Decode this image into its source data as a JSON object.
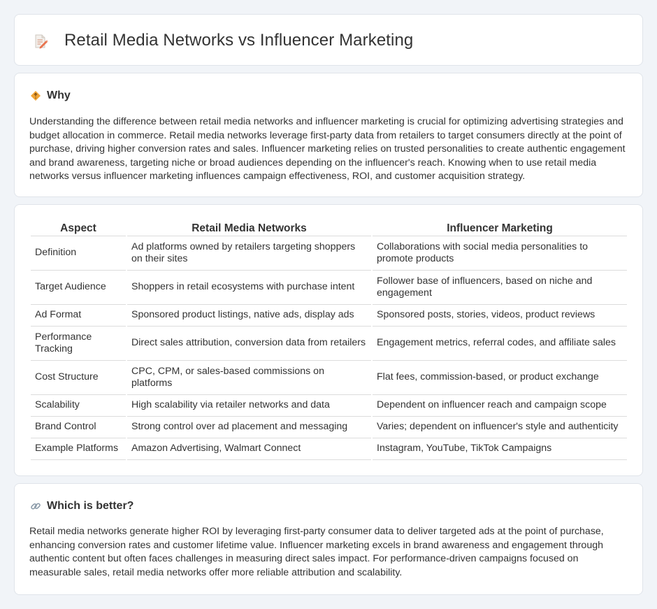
{
  "header": {
    "title": "Retail Media Networks vs Influencer Marketing",
    "icon": "document-pencil-icon"
  },
  "why": {
    "heading": "Why",
    "icon": "diamond-sign-icon",
    "text": "Understanding the difference between retail media networks and influencer marketing is crucial for optimizing advertising strategies and budget allocation in commerce. Retail media networks leverage first-party data from retailers to target consumers directly at the point of purchase, driving higher conversion rates and sales. Influencer marketing relies on trusted personalities to create authentic engagement and brand awareness, targeting niche or broad audiences depending on the influencer's reach. Knowing when to use retail media networks versus influencer marketing influences campaign effectiveness, ROI, and customer acquisition strategy."
  },
  "table": {
    "headers": [
      "Aspect",
      "Retail Media Networks",
      "Influencer Marketing"
    ],
    "rows": [
      [
        "Definition",
        "Ad platforms owned by retailers targeting shoppers on their sites",
        "Collaborations with social media personalities to promote products"
      ],
      [
        "Target Audience",
        "Shoppers in retail ecosystems with purchase intent",
        "Follower base of influencers, based on niche and engagement"
      ],
      [
        "Ad Format",
        "Sponsored product listings, native ads, display ads",
        "Sponsored posts, stories, videos, product reviews"
      ],
      [
        "Performance Tracking",
        "Direct sales attribution, conversion data from retailers",
        "Engagement metrics, referral codes, and affiliate sales"
      ],
      [
        "Cost Structure",
        "CPC, CPM, or sales-based commissions on platforms",
        "Flat fees, commission-based, or product exchange"
      ],
      [
        "Scalability",
        "High scalability via retailer networks and data",
        "Dependent on influencer reach and campaign scope"
      ],
      [
        "Brand Control",
        "Strong control over ad placement and messaging",
        "Varies; dependent on influencer's style and authenticity"
      ],
      [
        "Example Platforms",
        "Amazon Advertising, Walmart Connect",
        "Instagram, YouTube, TikTok Campaigns"
      ]
    ]
  },
  "better": {
    "heading": "Which is better?",
    "icon": "link-icon",
    "text": "Retail media networks generate higher ROI by leveraging first-party consumer data to deliver targeted ads at the point of purchase, enhancing conversion rates and customer lifetime value. Influencer marketing excels in brand awareness and engagement through authentic content but often faces challenges in measuring direct sales impact. For performance-driven campaigns focused on measurable sales, retail media networks offer more reliable attribution and scalability."
  }
}
